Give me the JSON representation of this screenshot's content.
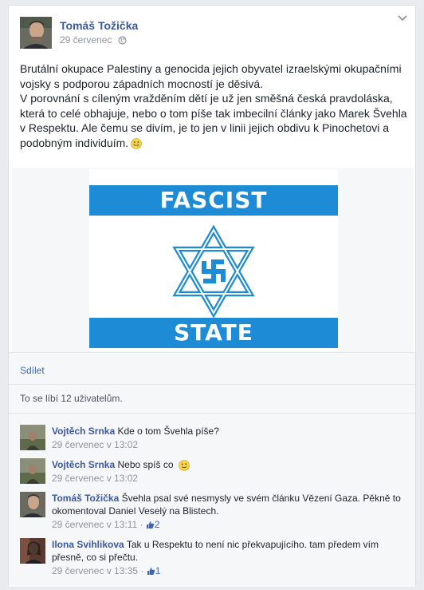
{
  "post": {
    "author": "Tomáš Tožička",
    "time": "29 červenec",
    "text_lines": [
      "Brutální okupace Palestiny a genocida jejich obyvatel izraelskými okupačními vojsky s podporou západních mocností je děsivá.",
      "V porovnání s cíleným vražděním dětí je už jen směšná česká pravdoláska, která to celé obhajuje, nebo o tom píše tak imbecilní články jako Marek Švehla v Respektu. Ale čemu se divím, je to jen v linii jejich obdivu k Pinochetovi a podobným individuím."
    ]
  },
  "image": {
    "top_text": "FASCIST",
    "bottom_text": "STATE",
    "flag_color": "#1e8bd6"
  },
  "actions": {
    "share": "Sdílet"
  },
  "likes_text": "To se líbí 12 uživatelům.",
  "comments": [
    {
      "author": "Vojtěch Srnka",
      "text": "Kde o tom Švehla píše?",
      "time": "29 červenec v 13:02",
      "likes": ""
    },
    {
      "author": "Vojtěch Srnka",
      "text": "Nebo spíš co",
      "time": "29 červenec v 13:02",
      "likes": ""
    },
    {
      "author": "Tomáš Tožička",
      "text": "Švehla psal své nesmysly ve svém článku Vězení Gaza. Pěkně to okomentoval Daniel Veselý na Blistech.",
      "time": "29 červenec v 13:11",
      "likes": "2"
    },
    {
      "author": "Ilona Svihlikova",
      "text": "Tak u Respektu to není nic překvapujícího. tam předem vím přesně, co si přečtu.",
      "time": "29 červenec v 13:35",
      "likes": "1"
    }
  ]
}
